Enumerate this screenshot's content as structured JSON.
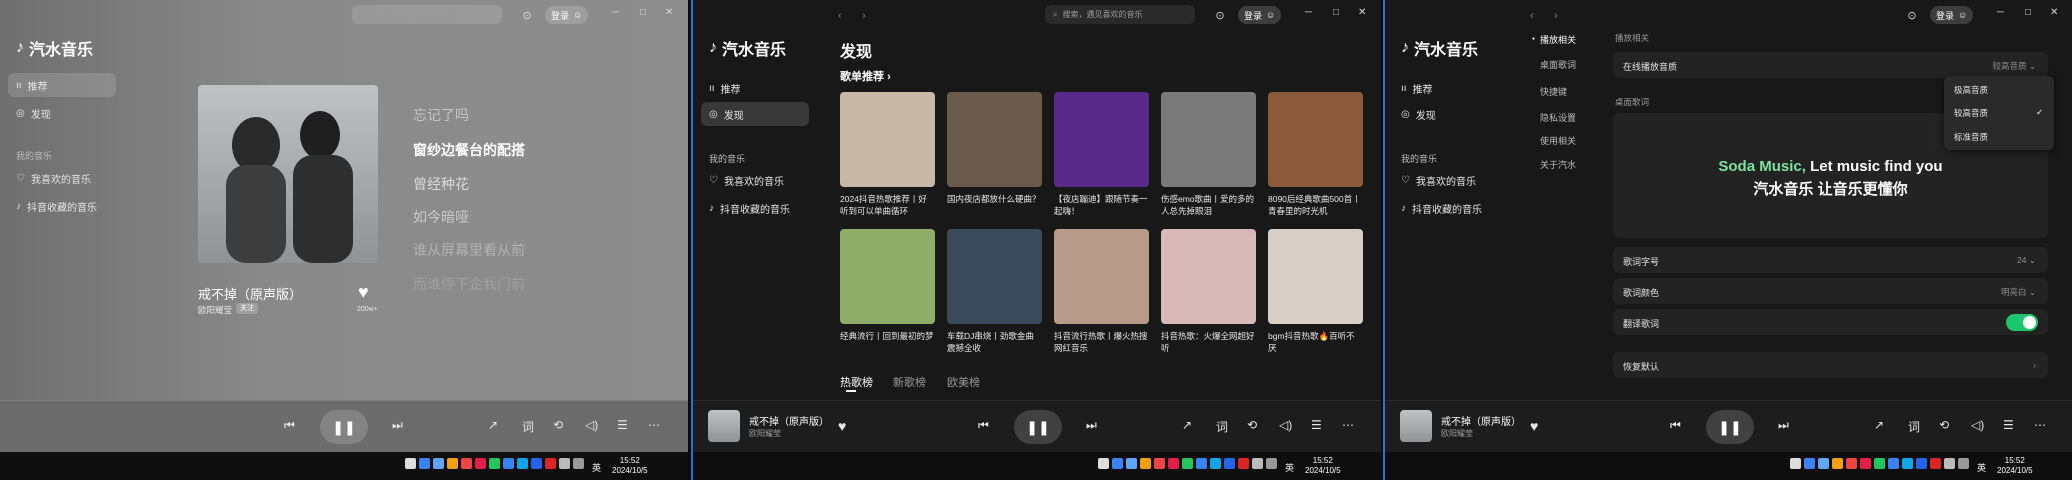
{
  "app": {
    "brand": "汽水音乐",
    "search_placeholder": "搜索，遇见喜欢的音乐",
    "login": "登录"
  },
  "nav": {
    "recommend": "推荐",
    "discover": "发现",
    "my_music": "我的音乐",
    "liked": "我喜欢的音乐",
    "douyin": "抖音收藏的音乐"
  },
  "panel1": {
    "song_title": "戒不掉（原声版）",
    "artist": "欧阳耀莹",
    "follow": "关注",
    "likes": "200w+",
    "lyrics": [
      "忘记了吗",
      "窗纱边餐台的配搭",
      "曾经种花",
      "如今暗哑",
      "谁从屏幕里看从前",
      "而谁停下企我门前"
    ]
  },
  "panel2": {
    "title": "发现",
    "section": "歌单推荐",
    "cards": [
      {
        "title": "2024抖音热歌推荐丨好听到可以单曲循环",
        "color": "#c9b8a8"
      },
      {
        "title": "国内夜店都放什么硬曲？",
        "color": "#6b5b4d"
      },
      {
        "title": "【夜店蹦迪】跟随节奏一起嗨！",
        "color": "#5a2a8a"
      },
      {
        "title": "伤感emo歌曲丨爱的多的人总先掉眼泪",
        "color": "#7a7a7a"
      },
      {
        "title": "8090后经典歌曲500首丨青春里的时光机",
        "color": "#8a5a3a"
      },
      {
        "title": "经典流行丨回到最初的梦",
        "color": "#8fae6a"
      },
      {
        "title": "车载DJ串烧丨劲歌金曲震撼全收",
        "color": "#3a4a5a"
      },
      {
        "title": "抖音流行热歌丨爆火热搜网红音乐",
        "color": "#b89a8a"
      },
      {
        "title": "抖音热歌：火爆全网超好听",
        "color": "#d8b8b8"
      },
      {
        "title": "bgm抖音热歌🔥百听不厌",
        "color": "#d8d0c8"
      }
    ],
    "tabs": [
      "热歌榜",
      "新歌榜",
      "欧美榜"
    ]
  },
  "panel3": {
    "side": [
      "播放相关",
      "桌面歌词",
      "快捷键",
      "隐私设置",
      "使用相关",
      "关于汽水"
    ],
    "section1": "播放相关",
    "online_quality_label": "在线播放音质",
    "online_quality_value": "较高音质",
    "menu": [
      "极高音质",
      "较高音质",
      "标准音质"
    ],
    "desktop_lyrics": "桌面歌词",
    "preview_en_brand": "Soda Music,",
    "preview_en_rest": " Let music find you",
    "preview_cn": "汽水音乐 让音乐更懂你",
    "font_size_label": "歌词字号",
    "font_size_value": "24",
    "color_label": "歌词颜色",
    "color_value": "明亮白",
    "translate_label": "翻译歌词",
    "reset_label": "恢复默认"
  },
  "player": {
    "song": "戒不掉（原声版）",
    "artist": "欧阳耀莹",
    "lyric_btn": "词"
  },
  "taskbar": {
    "ime": "英",
    "time": "15:52",
    "date": "2024/10/5"
  },
  "colors": {
    "accent": "#1ec66b",
    "brand_green": "#7be39d"
  }
}
